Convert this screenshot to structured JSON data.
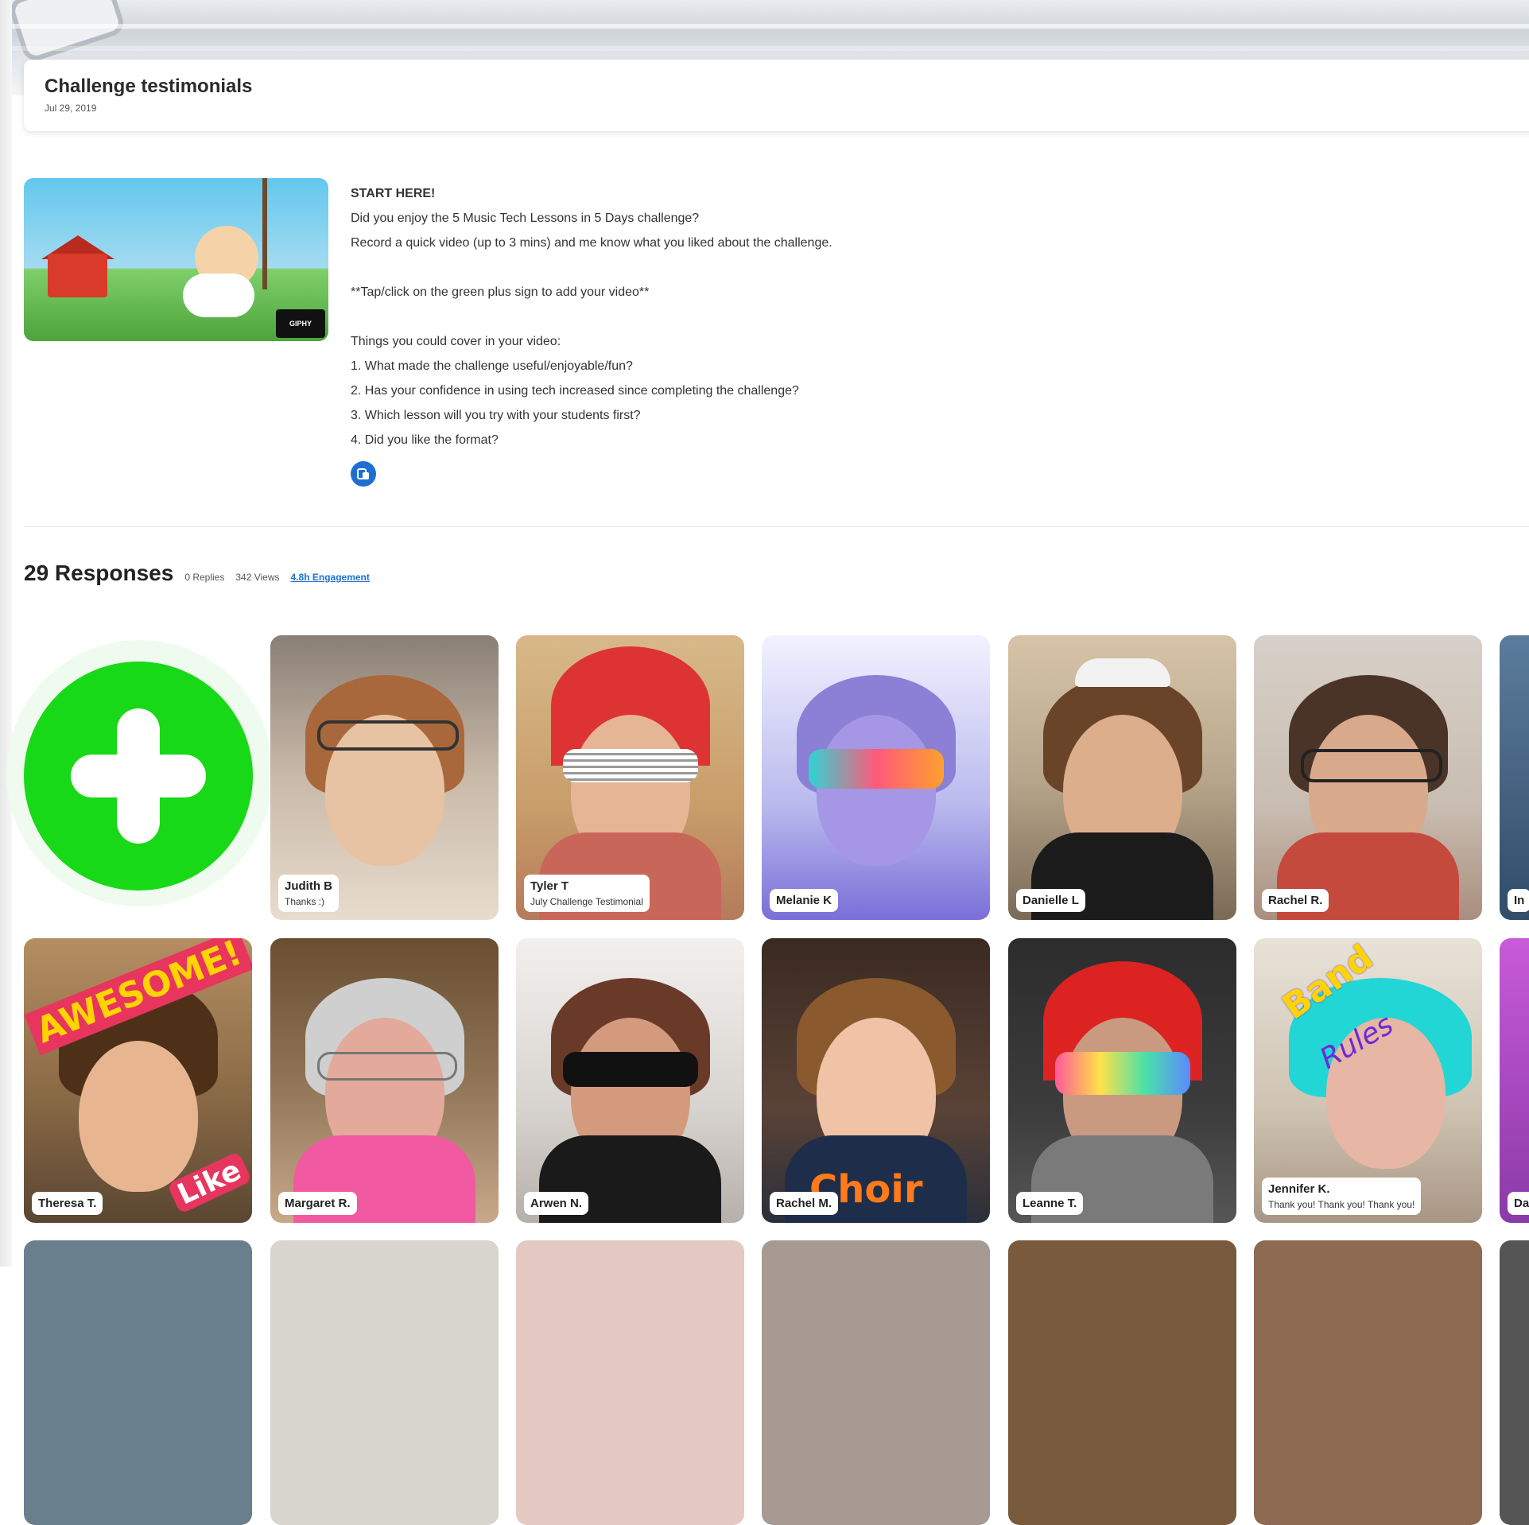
{
  "topic": {
    "title": "Challenge testimonials",
    "date": "Jul 29, 2019",
    "gif_badge": "GIPHY",
    "prompt": {
      "heading": "START HERE!",
      "line1": "Did you enjoy the 5 Music Tech Lessons in 5 Days challenge?",
      "line2": "Record a quick video (up to 3 mins) and me know what you liked about the challenge.",
      "tip": "**Tap/click on the green plus sign to add your video**",
      "list_intro": "Things you could cover in your video:",
      "q1": "1. What made the challenge useful/enjoyable/fun?",
      "q2": "2. Has your confidence in using tech increased since completing the challenge?",
      "q3": "3. Which lesson will you try with your students first?",
      "q4": "4. Did you like the format?"
    }
  },
  "responses": {
    "count_label": "29 Responses",
    "replies": "0 Replies",
    "views": "342 Views",
    "engagement": "4.8h Engagement"
  },
  "tiles": [
    {
      "name": "Judith B",
      "caption": "Thanks :)"
    },
    {
      "name": "Tyler T",
      "caption": "July Challenge Testimonial"
    },
    {
      "name": "Melanie K",
      "caption": ""
    },
    {
      "name": "Danielle L",
      "caption": ""
    },
    {
      "name": "Rachel R.",
      "caption": ""
    },
    {
      "name": "In",
      "caption": ""
    },
    {
      "name": "Theresa T.",
      "caption": ""
    },
    {
      "name": "Margaret R.",
      "caption": ""
    },
    {
      "name": "Arwen N.",
      "caption": ""
    },
    {
      "name": "Rachel M.",
      "caption": ""
    },
    {
      "name": "Leanne T.",
      "caption": ""
    },
    {
      "name": "Jennifer K.",
      "caption": "Thank you! Thank you! Thank you!"
    },
    {
      "name": "Da",
      "caption": ""
    }
  ],
  "stickers": {
    "awesome": "AWESOME!",
    "like": "Like",
    "choir": "Choir",
    "band": "Band",
    "rules": "Rules"
  },
  "colors": {
    "add_green": "#18d918",
    "link_blue": "#1e6fd1"
  },
  "icons": {
    "add": "plus-icon",
    "attachment": "attachment-icon"
  }
}
